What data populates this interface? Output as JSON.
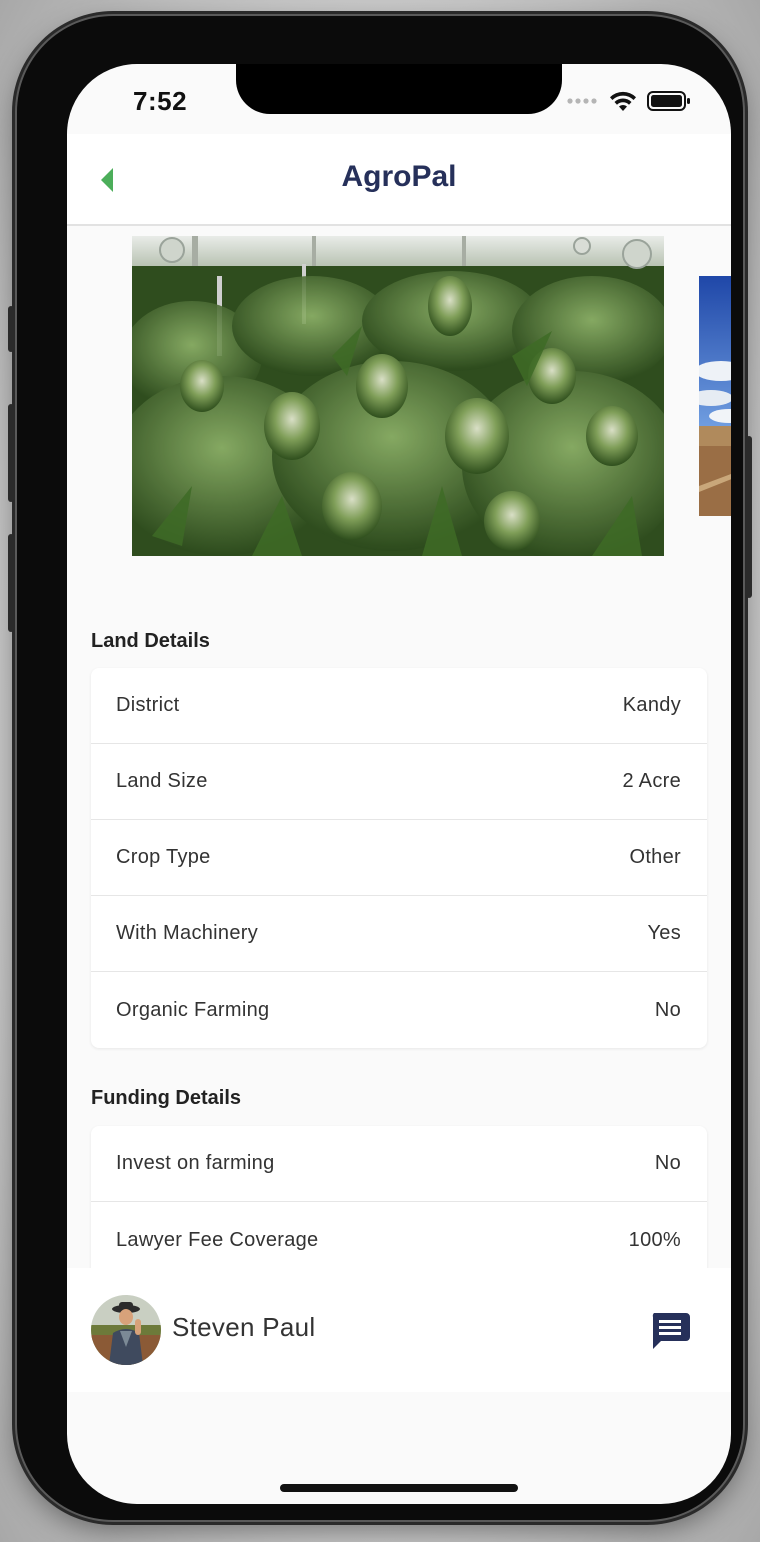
{
  "status_bar": {
    "time": "7:52",
    "icons": [
      "signal-dots-icon",
      "wifi-icon",
      "battery-icon"
    ]
  },
  "nav": {
    "title": "AgroPal",
    "back_icon": "chevron-left-icon"
  },
  "gallery": {
    "images": [
      "cannabis-crop-photo",
      "farmland-sky-photo"
    ]
  },
  "land_details": {
    "title": "Land Details",
    "rows": [
      {
        "label": "District",
        "value": "Kandy"
      },
      {
        "label": "Land Size",
        "value": "2 Acre"
      },
      {
        "label": "Crop Type",
        "value": "Other"
      },
      {
        "label": "With Machinery",
        "value": "Yes"
      },
      {
        "label": "Organic Farming",
        "value": "No"
      }
    ]
  },
  "funding_details": {
    "title": "Funding Details",
    "rows": [
      {
        "label": "Invest on farming",
        "value": "No"
      },
      {
        "label": "Lawyer Fee Coverage",
        "value": "100%"
      }
    ]
  },
  "owner": {
    "name": "Steven Paul",
    "chat_icon": "chat-bubble-icon"
  },
  "colors": {
    "accent_green": "#4cae5a",
    "title_navy": "#26305a",
    "chat_navy": "#26305a"
  }
}
